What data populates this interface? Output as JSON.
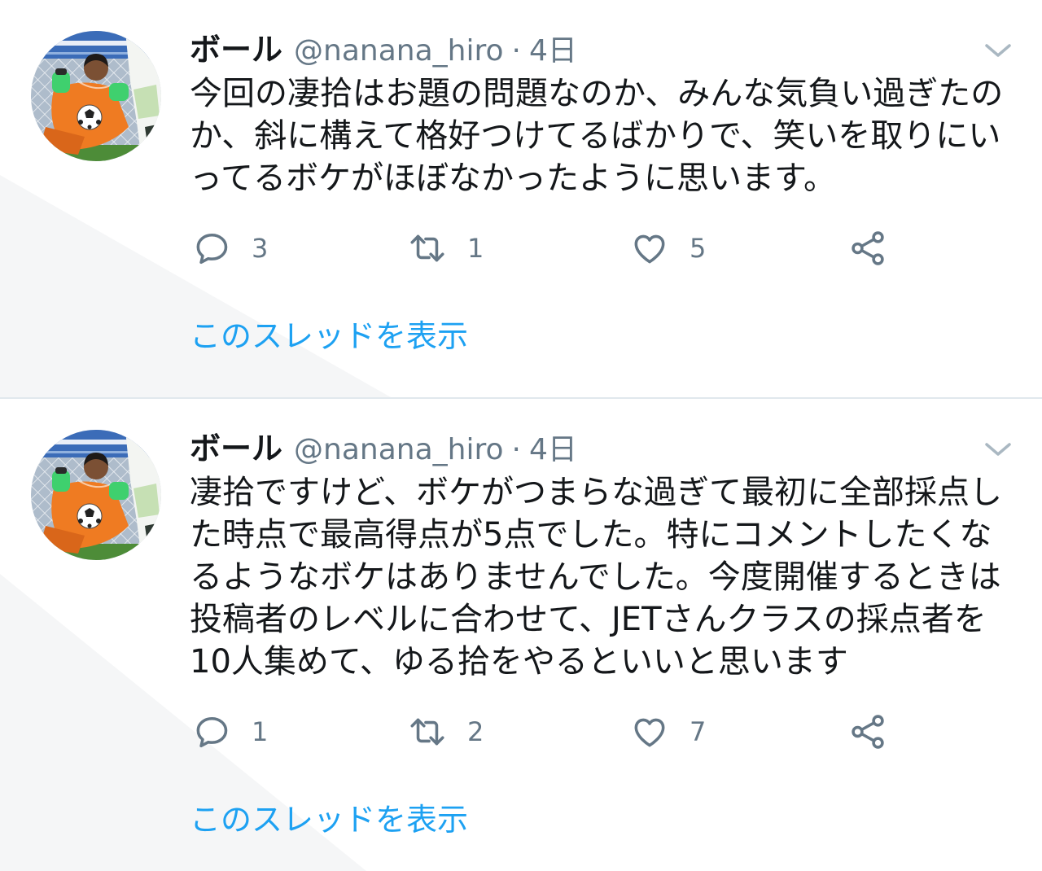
{
  "tweets": [
    {
      "author": {
        "name": "ボール",
        "handle": "@nanana_hiro"
      },
      "separator": "·",
      "time": "4日",
      "text_lines": [
        "今回の凄拾はお題の問題なのか、みんな気負い過ぎたの",
        "か、斜に構えて格好つけてるばかりで、笑いを取りにい",
        "ってるボケがほぼなかったように思います。"
      ],
      "actions": {
        "replies": 3,
        "retweets": 1,
        "likes": 5
      },
      "show_thread_label": "このスレッドを表示"
    },
    {
      "author": {
        "name": "ボール",
        "handle": "@nanana_hiro"
      },
      "separator": "·",
      "time": "4日",
      "text_lines": [
        "凄拾ですけど、ボケがつまらな過ぎて最初に全部採点し",
        "た時点で最高得点が5点でした。特にコメントしたくな",
        "るようなボケはありませんでした。今度開催するときは",
        "投稿者のレベルに合わせて、JETさんクラスの採点者を",
        "10人集めて、ゆる拾をやるといいと思います"
      ],
      "actions": {
        "replies": 1,
        "retweets": 2,
        "likes": 7
      },
      "show_thread_label": "このスレッドを表示"
    }
  ],
  "icons": {
    "reply": "reply-icon",
    "retweet": "retweet-icon",
    "like": "like-icon",
    "share": "share-icon",
    "menu": "chevron-down-icon"
  },
  "colors": {
    "text": "#14171a",
    "secondary_text": "#657786",
    "link": "#1da1f2",
    "divider": "#e1e8ed",
    "icon": "#657786",
    "chevron": "#aab8c2"
  }
}
